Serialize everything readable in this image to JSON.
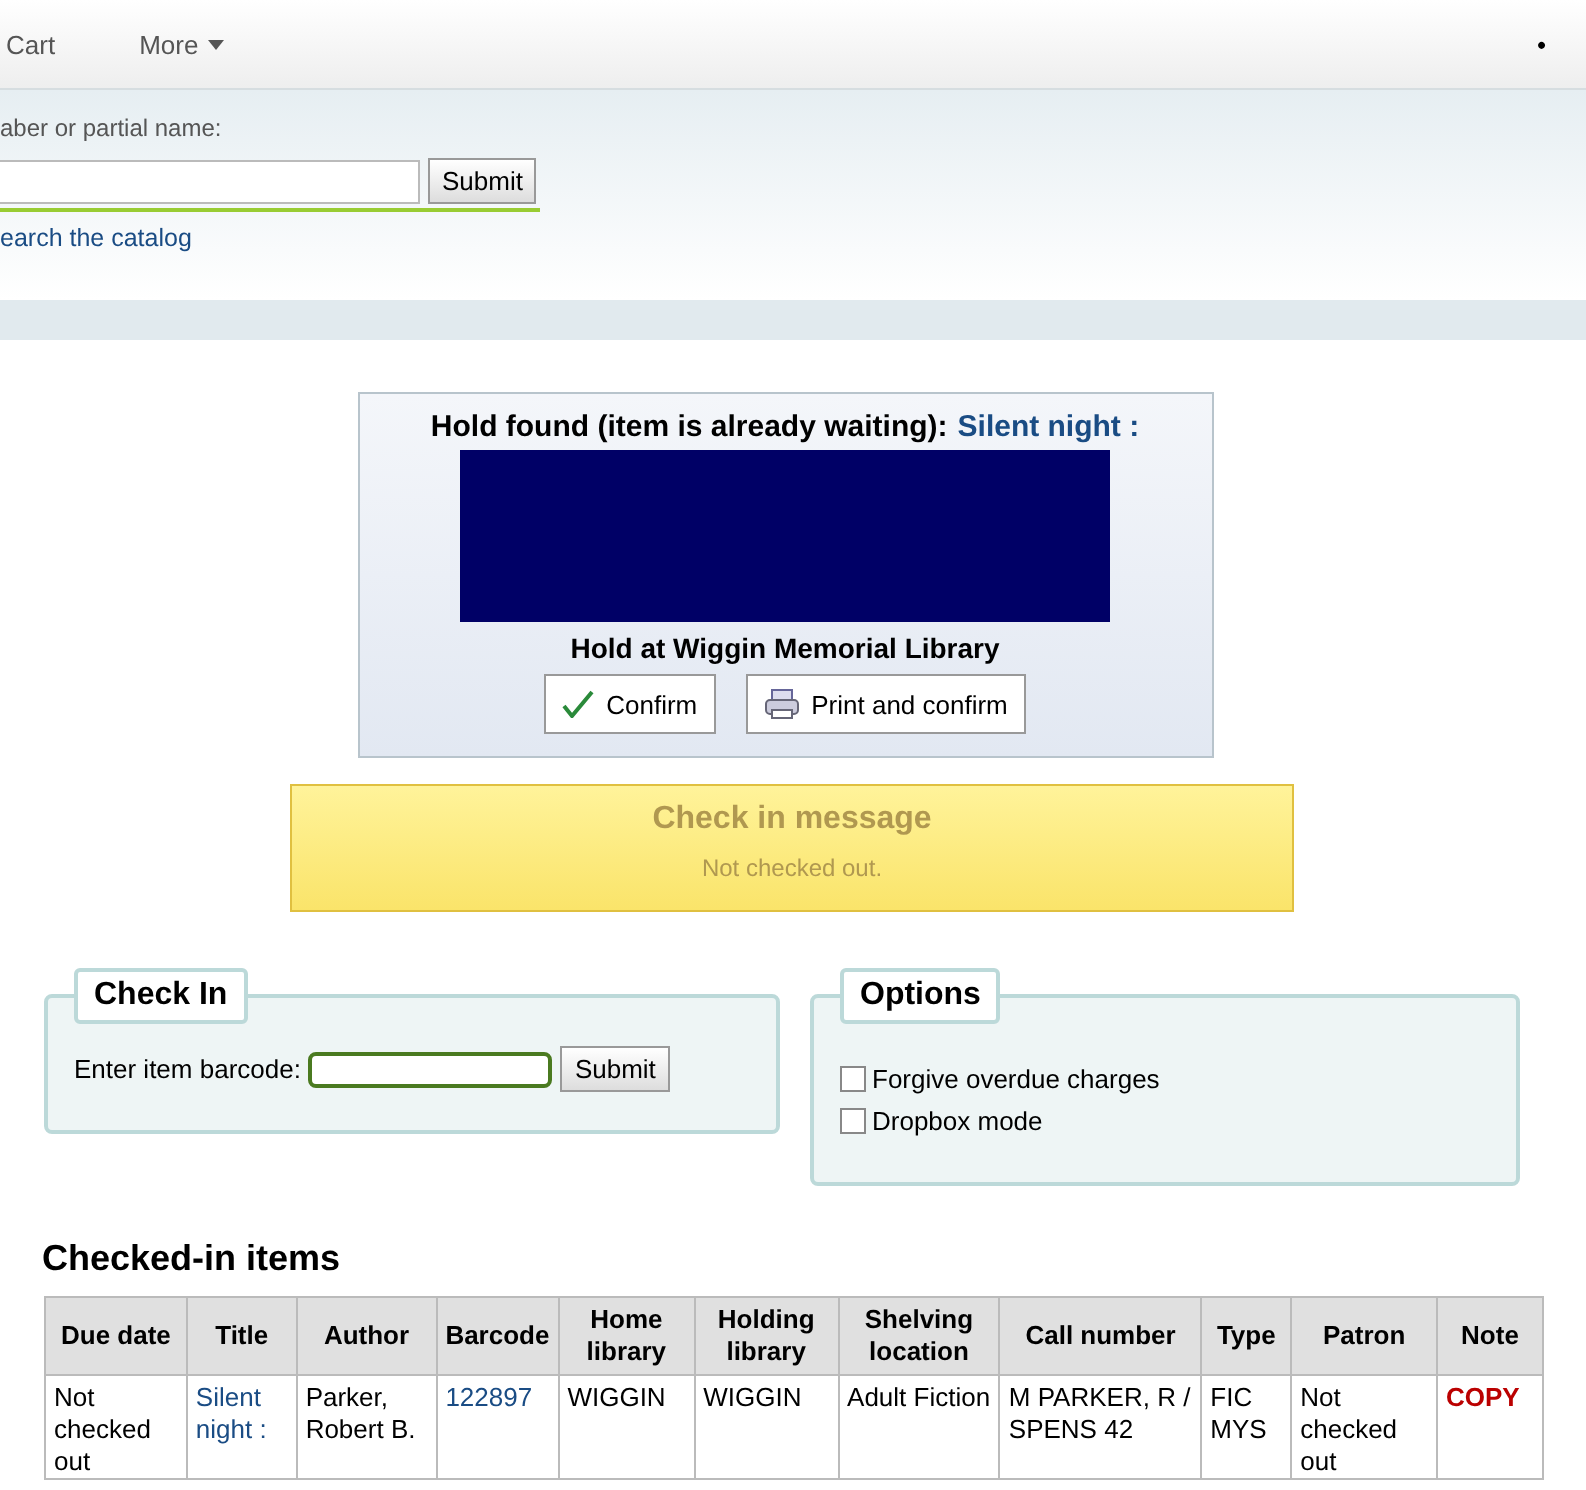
{
  "nav": {
    "items": [
      {
        "label": "Cart",
        "dropdown": false
      },
      {
        "label": "More",
        "dropdown": true
      }
    ],
    "bullet": "•"
  },
  "search": {
    "label": "aber or partial name:",
    "button": "Submit",
    "link": "earch the catalog"
  },
  "hold": {
    "heading": "Hold found (item is already waiting):",
    "title": "Silent night :",
    "location": "Hold at Wiggin Memorial Library",
    "buttons": [
      {
        "kind": "confirm",
        "label": "Confirm"
      },
      {
        "kind": "print",
        "label": "Print and confirm"
      }
    ]
  },
  "message": {
    "title": "Check in message",
    "text": "Not checked out."
  },
  "checkin": {
    "legend": "Check In",
    "label": "Enter item barcode:",
    "button": "Submit"
  },
  "options": {
    "legend": "Options",
    "items": [
      {
        "label": "Forgive overdue charges",
        "checked": false
      },
      {
        "label": "Dropbox mode",
        "checked": false
      }
    ]
  },
  "table": {
    "title": "Checked-in items",
    "columns": [
      "Due date",
      "Title",
      "Author",
      "Barcode",
      "Home library",
      "Holding library",
      "Shelving location",
      "Call number",
      "Type",
      "Patron",
      "Note"
    ],
    "rows": [
      {
        "cells": [
          {
            "text": "Not checked out",
            "kind": "text"
          },
          {
            "text": "Silent night :",
            "kind": "link"
          },
          {
            "text": "Parker, Robert B.",
            "kind": "text"
          },
          {
            "text": "122897",
            "kind": "link"
          },
          {
            "text": "WIGGIN",
            "kind": "text"
          },
          {
            "text": "WIGGIN",
            "kind": "text"
          },
          {
            "text": "Adult Fiction",
            "kind": "text"
          },
          {
            "text": "M PARKER, R / SPENS 42",
            "kind": "text"
          },
          {
            "text": "FIC MYS",
            "kind": "text"
          },
          {
            "text": "Not checked out",
            "kind": "text"
          },
          {
            "text": "COPY",
            "kind": "alert"
          }
        ]
      }
    ]
  }
}
